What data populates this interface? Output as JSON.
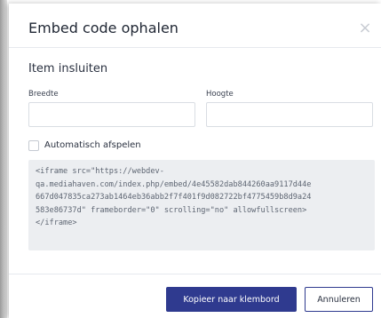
{
  "modal": {
    "title": "Embed code ophalen",
    "close_symbol": "×"
  },
  "section": {
    "title": "Item insluiten"
  },
  "fields": {
    "width_label": "Breedte",
    "width_value": "",
    "height_label": "Hoogte",
    "height_value": ""
  },
  "autoplay": {
    "label": "Automatisch afspelen",
    "checked": false
  },
  "embed_code": {
    "lines": [
      "<iframe src=\"https://webdev-",
      "qa.mediahaven.com/index.php/embed/4e45582dab844260aa9117d44e",
      "667d047835ca273ab1464eb36abb2f7f401f9d082722bf4775459b8d9a24",
      "583e86737d\" frameborder=\"0\" scrolling=\"no\" allowfullscreen>",
      "</iframe>"
    ]
  },
  "footer": {
    "copy_label": "Kopieer naar klembord",
    "cancel_label": "Annuleren"
  },
  "colors": {
    "primary": "#2f3a8f",
    "code_background": "#eceef1"
  },
  "icons": {
    "close": "close-icon",
    "checkbox": "checkbox-unchecked"
  }
}
